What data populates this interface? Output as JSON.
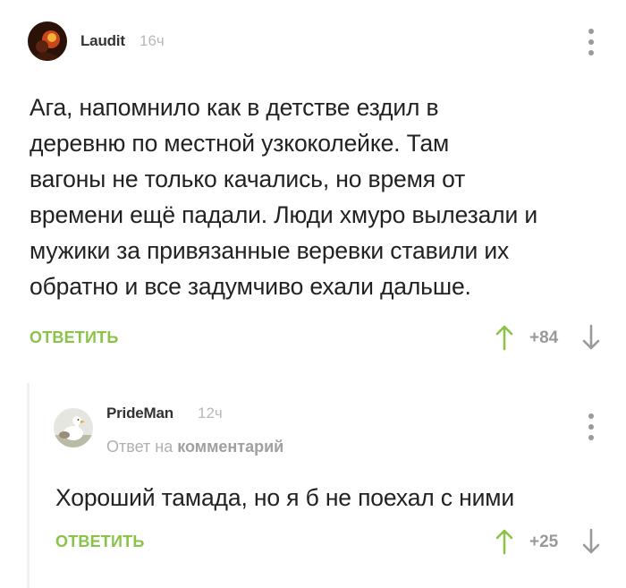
{
  "comments": [
    {
      "username": "Laudit",
      "time": "16ч",
      "text_lines": [
        "Ага, напомнило как в детстве ездил в",
        "деревню по местной узкоколейке. Там",
        "вагоны не только качались, но время от",
        "времени ещё падали. Люди хмуро вылезали и",
        "мужики за привязанные веревки ставили их",
        "обратно и все задумчиво ехали дальше."
      ],
      "reply_label": "ОТВЕТИТЬ",
      "score": "+84"
    },
    {
      "username": "PrideMan",
      "time": "12ч",
      "reply_to_prefix": "Ответ на",
      "reply_to_target": "комментарий",
      "text_lines": [
        "Хороший тамада, но я б не поехал с ними"
      ],
      "reply_label": "ОТВЕТИТЬ",
      "score": "+25"
    }
  ],
  "colors": {
    "accent": "#8bc34a",
    "muted": "#9a9a9a"
  },
  "icons": [
    "more-vertical-icon",
    "arrow-up-icon",
    "arrow-down-icon"
  ]
}
